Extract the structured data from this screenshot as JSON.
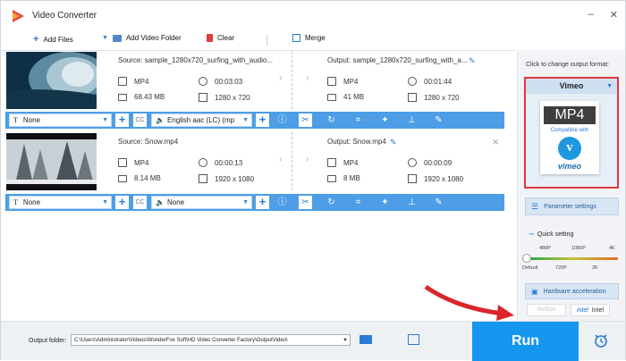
{
  "window": {
    "title": "Video Converter",
    "controls": [
      "–",
      "✕"
    ]
  },
  "toolbar": {
    "add_files": "Add Files",
    "add_video_folder": "Add Video Folder",
    "clear": "Clear",
    "merge": "Merge"
  },
  "files": [
    {
      "source": "Source: sample_1280x720_surfing_with_audio...",
      "output": "Output: sample_1280x720_surfing_with_a...",
      "src_format": "MP4",
      "src_duration": "00:03:03",
      "src_size": "68.43 MB",
      "src_resolution": "1280 x 720",
      "out_format": "MP4",
      "out_duration": "00:01:44",
      "out_size": "41 MB",
      "out_resolution": "1280 x 720",
      "subtitle": "None",
      "audio": "English aac (LC) (mp"
    },
    {
      "source": "Source: Snow.mp4",
      "output": "Output: Snow.mp4",
      "src_format": "MP4",
      "src_duration": "00:00:13",
      "src_size": "8.14 MB",
      "src_resolution": "1920 x 1080",
      "out_format": "MP4",
      "out_duration": "00:00:09",
      "out_size": "8 MB",
      "out_resolution": "1920 x 1080",
      "subtitle": "None",
      "audio": "None"
    }
  ],
  "right_panel": {
    "hint": "Click to change output format:",
    "format_name": "Vimeo",
    "card_format": "MP4",
    "card_compat": "Compatible with",
    "card_brand": "vimeo",
    "param_settings": "Parameter settings",
    "quick_setting": "Quick setting",
    "ticks_top": [
      "480P",
      "1080P",
      "4K"
    ],
    "ticks_bottom": [
      "Default",
      "720P",
      "2K"
    ],
    "hw_accel": "Hardware acceleration",
    "nvidia": "NVIDIA",
    "intel": "Intel"
  },
  "bottom": {
    "output_folder_label": "Output folder:",
    "output_path": "C:\\Users\\Administrator\\Videos\\WonderFox Soft\\HD Video Converter Factory\\OutputVideo\\",
    "run": "Run"
  },
  "colors": {
    "accent": "#4d9ee6",
    "run": "#1597ef",
    "highlight": "#e0393e"
  }
}
